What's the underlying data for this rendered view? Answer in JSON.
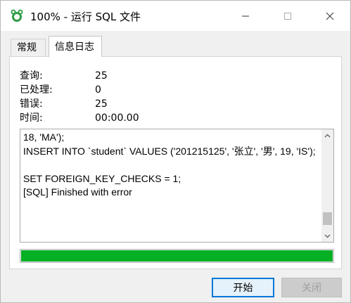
{
  "window": {
    "title": "100% - 运行 SQL 文件"
  },
  "tabs": [
    {
      "label": "常规"
    },
    {
      "label": "信息日志"
    }
  ],
  "stats": [
    {
      "label": "查询:",
      "value": "25"
    },
    {
      "label": "已处理:",
      "value": "0"
    },
    {
      "label": "错误:",
      "value": "25"
    },
    {
      "label": "时间:",
      "value": "00:00.00"
    }
  ],
  "log": {
    "text": "18, 'MA');\nINSERT INTO `student` VALUES ('201215125', '张立', '男', 19, 'IS');\n\nSET FOREIGN_KEY_CHECKS = 1;\n[SQL] Finished with error"
  },
  "progress": {
    "percent": 100,
    "color": "#06b025"
  },
  "buttons": {
    "start_label": "开始",
    "close_label": "关闭"
  }
}
